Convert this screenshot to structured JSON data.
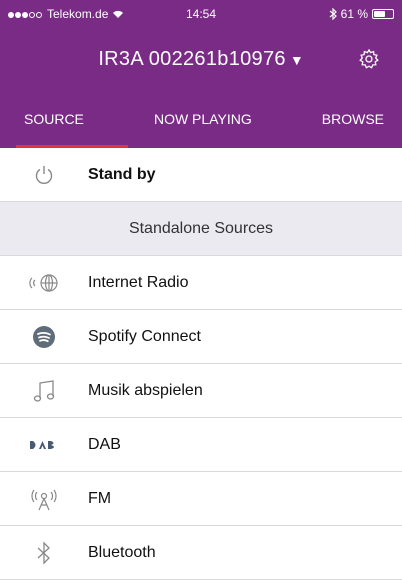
{
  "status_bar": {
    "carrier": "Telekom.de",
    "time": "14:54",
    "battery_text": "61 %",
    "battery_level": 0.61
  },
  "header": {
    "device_name": "IR3A 002261b10976",
    "dropdown_glyph": "▼",
    "settings_icon": "gear-icon"
  },
  "tabs": [
    {
      "label": "SOURCE",
      "active": true
    },
    {
      "label": "NOW PLAYING",
      "active": false
    },
    {
      "label": "BROWSE",
      "active": false
    }
  ],
  "colors": {
    "header_bg": "#7a2b86",
    "active_tab_indicator": "#e1343b",
    "section_bg": "#ebeaf0"
  },
  "standby": {
    "label": "Stand by",
    "icon": "power-icon"
  },
  "section_header": "Standalone Sources",
  "sources": [
    {
      "label": "Internet Radio",
      "icon": "globe-radio-icon"
    },
    {
      "label": "Spotify Connect",
      "icon": "spotify-icon"
    },
    {
      "label": "Musik abspielen",
      "icon": "music-note-icon"
    },
    {
      "label": "DAB",
      "icon": "dab-icon"
    },
    {
      "label": "FM",
      "icon": "fm-antenna-icon"
    },
    {
      "label": "Bluetooth",
      "icon": "bluetooth-icon"
    }
  ]
}
